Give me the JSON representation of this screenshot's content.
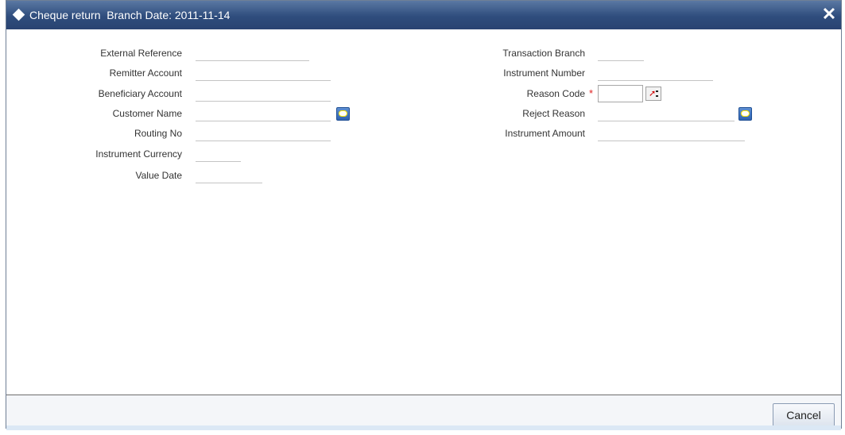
{
  "window": {
    "title": "Cheque return  Branch Date: 2011-11-14",
    "close_icon": "close-icon"
  },
  "left_fields": [
    {
      "label": "External Reference",
      "value": ""
    },
    {
      "label": "Remitter Account",
      "value": ""
    },
    {
      "label": "Beneficiary Account",
      "value": ""
    },
    {
      "label": "Customer Name",
      "value": ""
    },
    {
      "label": "Routing No",
      "value": ""
    },
    {
      "label": "Instrument Currency",
      "value": ""
    },
    {
      "label": "Value Date",
      "value": ""
    }
  ],
  "right_fields": [
    {
      "label": "Transaction Branch",
      "value": ""
    },
    {
      "label": "Instrument Number",
      "value": ""
    },
    {
      "label": "Reason Code",
      "value": "",
      "required": "*"
    },
    {
      "label": "Reject Reason",
      "value": ""
    },
    {
      "label": "Instrument Amount",
      "value": ""
    }
  ],
  "footer": {
    "cancel_label": "Cancel"
  },
  "colors": {
    "titlebar": "#2f4d7d",
    "required": "#e02020"
  }
}
